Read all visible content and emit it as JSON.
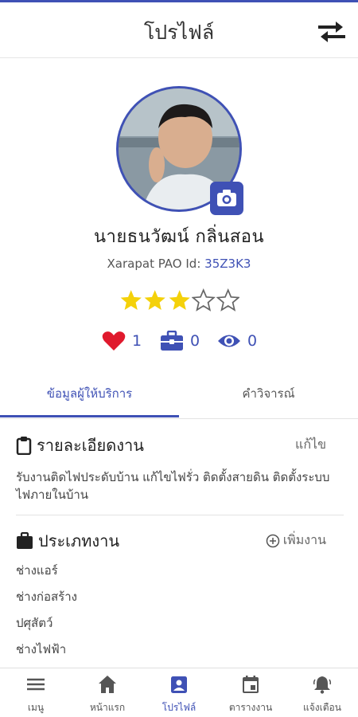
{
  "header": {
    "title": "โปรไฟล์",
    "switch_icon": "swap-arrows-icon"
  },
  "profile": {
    "name": "นายธนวัฒน์ กลิ่นสอน",
    "id_label": "Xarapat PAO Id:",
    "id_value": "35Z3K3",
    "rating": 3,
    "rating_max": 5,
    "likes": "1",
    "jobs": "0",
    "views": "0"
  },
  "tabs": [
    {
      "label": "ข้อมูลผู้ให้บริการ",
      "active": true
    },
    {
      "label": "คำวิจารณ์",
      "active": false
    }
  ],
  "job_detail": {
    "title": "รายละเอียดงาน",
    "action": "แก้ไข",
    "description": "รับงานติดไฟประดับบ้าน แก้ไขไฟรั่ว ติดตั้งสายดิน ติดตั้งระบบไฟภายในบ้าน"
  },
  "job_types": {
    "title": "ประเภทงาน",
    "action": "เพิ่มงาน",
    "items": [
      "ช่างแอร์",
      "ช่างก่อสร้าง",
      "ปศุสัตว์",
      "ช่างไฟฟ้า"
    ]
  },
  "nav": [
    {
      "label": "เมนู",
      "icon": "menu-icon",
      "active": false
    },
    {
      "label": "หน้าแรก",
      "icon": "home-icon",
      "active": false
    },
    {
      "label": "โปรไฟล์",
      "icon": "profile-icon",
      "active": true
    },
    {
      "label": "ตารางงาน",
      "icon": "calendar-icon",
      "active": false
    },
    {
      "label": "แจ้งเตือน",
      "icon": "bell-icon",
      "active": false
    }
  ],
  "colors": {
    "accent": "#3f51b5",
    "star": "#f4d10a",
    "heart": "#e0192d"
  }
}
